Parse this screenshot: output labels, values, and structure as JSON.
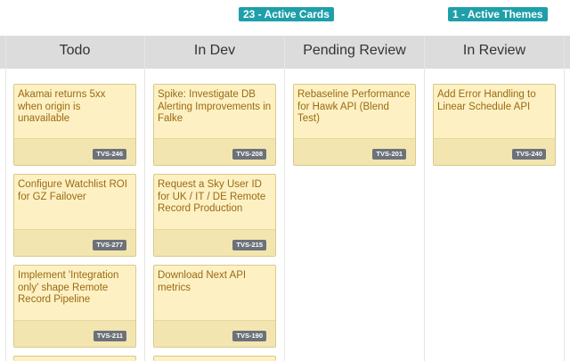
{
  "summary": {
    "active_cards": "23 - Active Cards",
    "active_themes": "1 - Active Themes"
  },
  "columns": [
    {
      "title": "Todo"
    },
    {
      "title": "In Dev"
    },
    {
      "title": "Pending Review"
    },
    {
      "title": "In Review"
    }
  ],
  "cards": {
    "todo": [
      {
        "title": "Akamai returns 5xx when origin is unavailable",
        "id": "TVS-246"
      },
      {
        "title": "Configure Watchlist ROI for GZ Failover",
        "id": "TVS-277"
      },
      {
        "title": "Implement 'Integration only' shape Remote Record Pipeline",
        "id": "TVS-211"
      }
    ],
    "in_dev": [
      {
        "title": "Spike: Investigate DB Alerting Improvements in Falke",
        "id": "TVS-208"
      },
      {
        "title": "Request a Sky User ID for UK / IT / DE Remote Record Production",
        "id": "TVS-215"
      },
      {
        "title": "Download Next API metrics",
        "id": "TVS-190"
      }
    ],
    "pending_review": [
      {
        "title": "Rebaseline Performance for Hawk API (Blend Test)",
        "id": "TVS-201"
      }
    ],
    "in_review": [
      {
        "title": "Add Error Handling to Linear Schedule API",
        "id": "TVS-240"
      }
    ]
  },
  "colors": {
    "badge_teal": "#1e9fa9",
    "header_gray": "#dcdcdc",
    "card_fill": "#fdf1c3",
    "card_text": "#9a6a14",
    "id_badge": "#6d7279"
  }
}
